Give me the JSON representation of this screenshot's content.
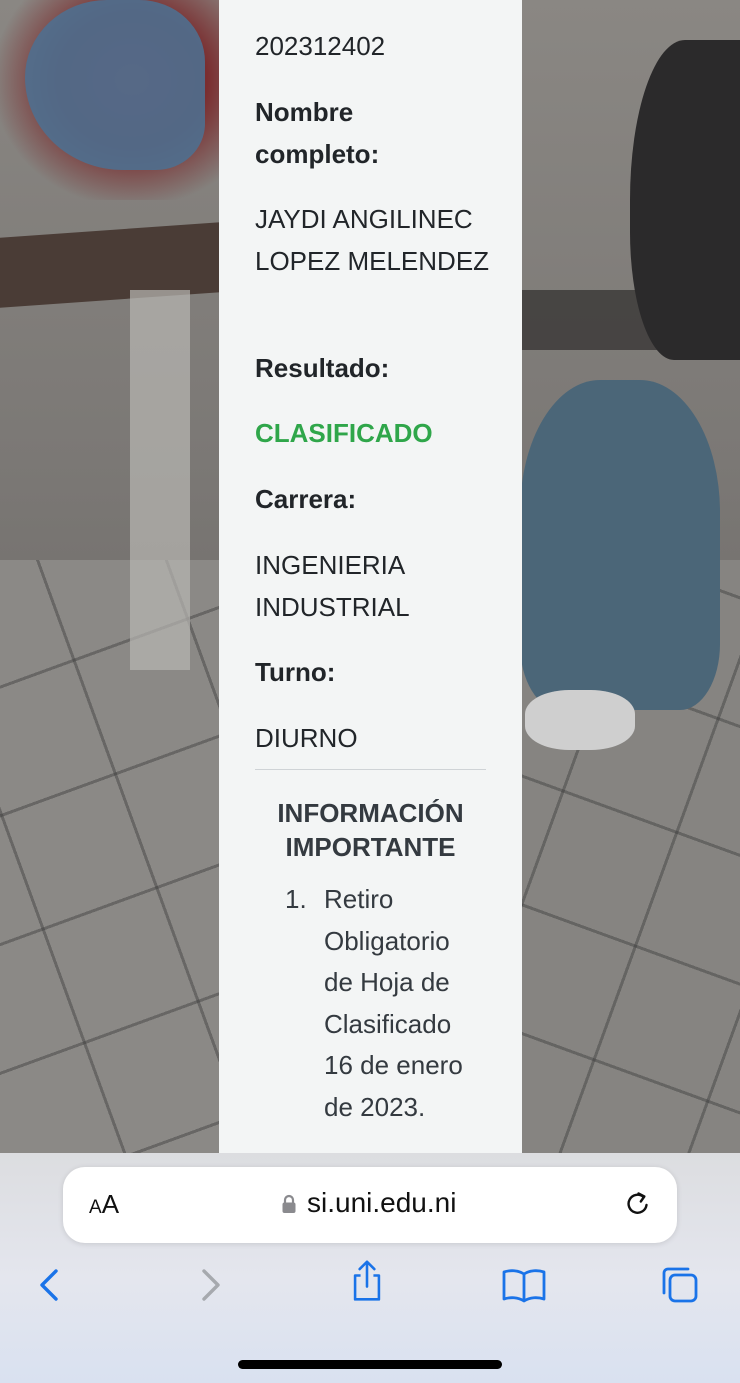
{
  "result": {
    "student_id": "202312402",
    "name_label": "Nombre completo:",
    "name_value": "JAYDI ANGILINEC LOPEZ MELENDEZ",
    "result_label": "Resultado:",
    "result_value": "CLASIFICADO",
    "career_label": "Carrera:",
    "career_value": "INGENIERIA INDUSTRIAL",
    "shift_label": "Turno:",
    "shift_value": "DIURNO"
  },
  "info": {
    "title": "INFORMACIÓN IMPORTANTE",
    "items": [
      {
        "number": "1.",
        "text": "Retiro Obligatorio de Hoja de Clasificado 16 de enero de 2023."
      }
    ]
  },
  "browser": {
    "text_size_button": {
      "small": "A",
      "big": "A"
    },
    "url": "si.uni.edu.ni",
    "icons": [
      "lock-icon",
      "reload-icon",
      "back-icon",
      "forward-icon",
      "share-icon",
      "bookmarks-icon",
      "tabs-icon"
    ]
  },
  "colors": {
    "status_green": "#2fa64a",
    "accent_blue": "#1a73e8",
    "disabled_gray": "#a6a9ae"
  }
}
